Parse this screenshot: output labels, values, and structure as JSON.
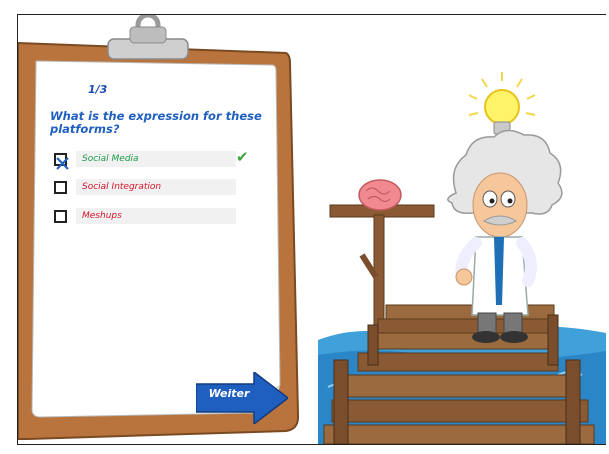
{
  "quiz": {
    "counter": "1/3",
    "question": "What is the expression for these platforms?",
    "options": [
      {
        "label": "Social Media",
        "checked": true,
        "correct": true
      },
      {
        "label": "Social Integration",
        "checked": false,
        "correct": false
      },
      {
        "label": "Meshups",
        "checked": false,
        "correct": false
      }
    ],
    "next_label": "Weiter"
  },
  "colors": {
    "sky": "#ffffff",
    "water": "#3fa0da",
    "clipboard": "#b8743c",
    "paper": "#ffffff",
    "accent_blue": "#1f5fbf",
    "correct_green": "#1e9a4a",
    "wrong_red": "#d3152b",
    "button_blue": "#1f5fbf"
  },
  "icons": {
    "check": "checkmark-icon",
    "next": "arrow-right-icon",
    "idea": "lightbulb-icon",
    "brain": "brain-icon"
  }
}
